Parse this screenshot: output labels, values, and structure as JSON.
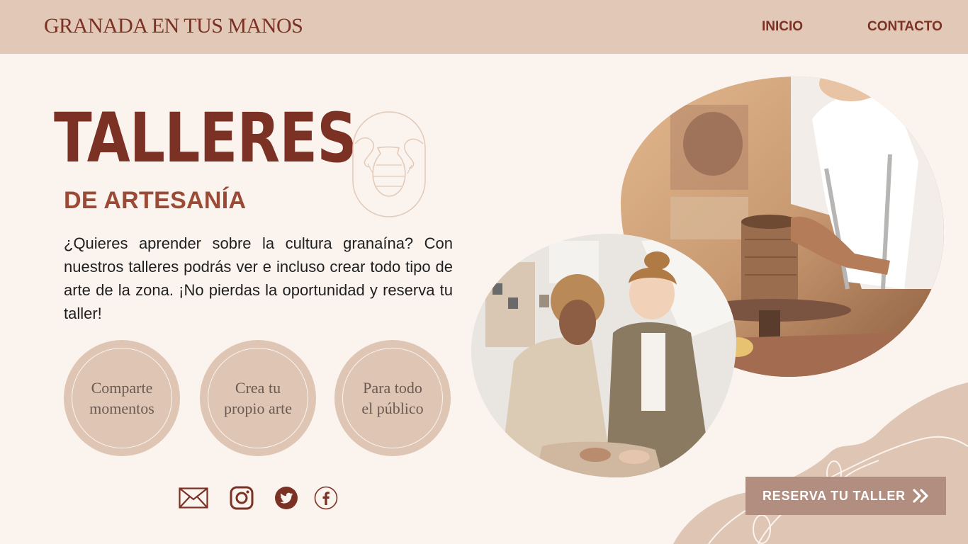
{
  "header": {
    "brand": "GRANADA EN TUS MANOS",
    "nav": [
      {
        "label": "INICIO"
      },
      {
        "label": "CONTACTO"
      }
    ]
  },
  "hero": {
    "title": "TALLERES",
    "subtitle": "DE ARTESANÍA",
    "description": "¿Quieres aprender sobre la cultura granaína? Con nuestros talleres podrás ver  e incluso crear todo tipo de arte de la zona. ¡No pierdas la oportunidad y reserva tu taller!"
  },
  "features": [
    {
      "line1": "Comparte",
      "line2": "momentos"
    },
    {
      "line1": "Crea tu",
      "line2": "propio arte"
    },
    {
      "line1": "Para todo",
      "line2": "el público"
    }
  ],
  "social": [
    {
      "icon": "mail-icon"
    },
    {
      "icon": "instagram-icon"
    },
    {
      "icon": "twitter-icon"
    },
    {
      "icon": "facebook-icon"
    }
  ],
  "cta": {
    "label": "RESERVA TU TALLER",
    "icon": "double-chevron-right-icon"
  },
  "colors": {
    "header_bg": "#e2c8b7",
    "page_bg": "#fbf3ee",
    "brand_dark": "#7b3225",
    "circle_bg": "#dfc6b4",
    "cta_bg": "#b18e80"
  }
}
